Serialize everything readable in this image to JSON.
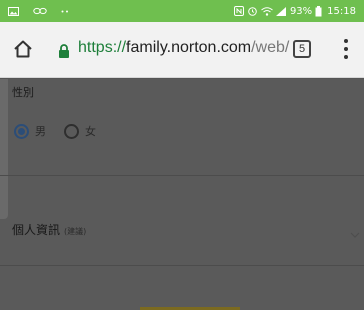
{
  "status_bar": {
    "battery": "93%",
    "time": "15:18",
    "icons": [
      "image-icon",
      "link-icon",
      "ellipsis-icon",
      "nfc-icon",
      "alarm-icon",
      "wifi-icon",
      "signal-icon",
      "battery-icon"
    ]
  },
  "browser": {
    "url_scheme": "https://",
    "url_host": "family.norton.com",
    "url_path": "/web/",
    "tab_count": "5"
  },
  "form": {
    "gender_label": "性別",
    "options": [
      {
        "label": "男",
        "selected": true
      },
      {
        "label": "女",
        "selected": false
      }
    ],
    "personal_info_title": "個人資訊",
    "personal_info_note": "(建議)"
  },
  "colors": {
    "status_bar": "#6fbf4f",
    "selected_radio": "#2b4d78",
    "overlay": "#5a5a5a"
  }
}
